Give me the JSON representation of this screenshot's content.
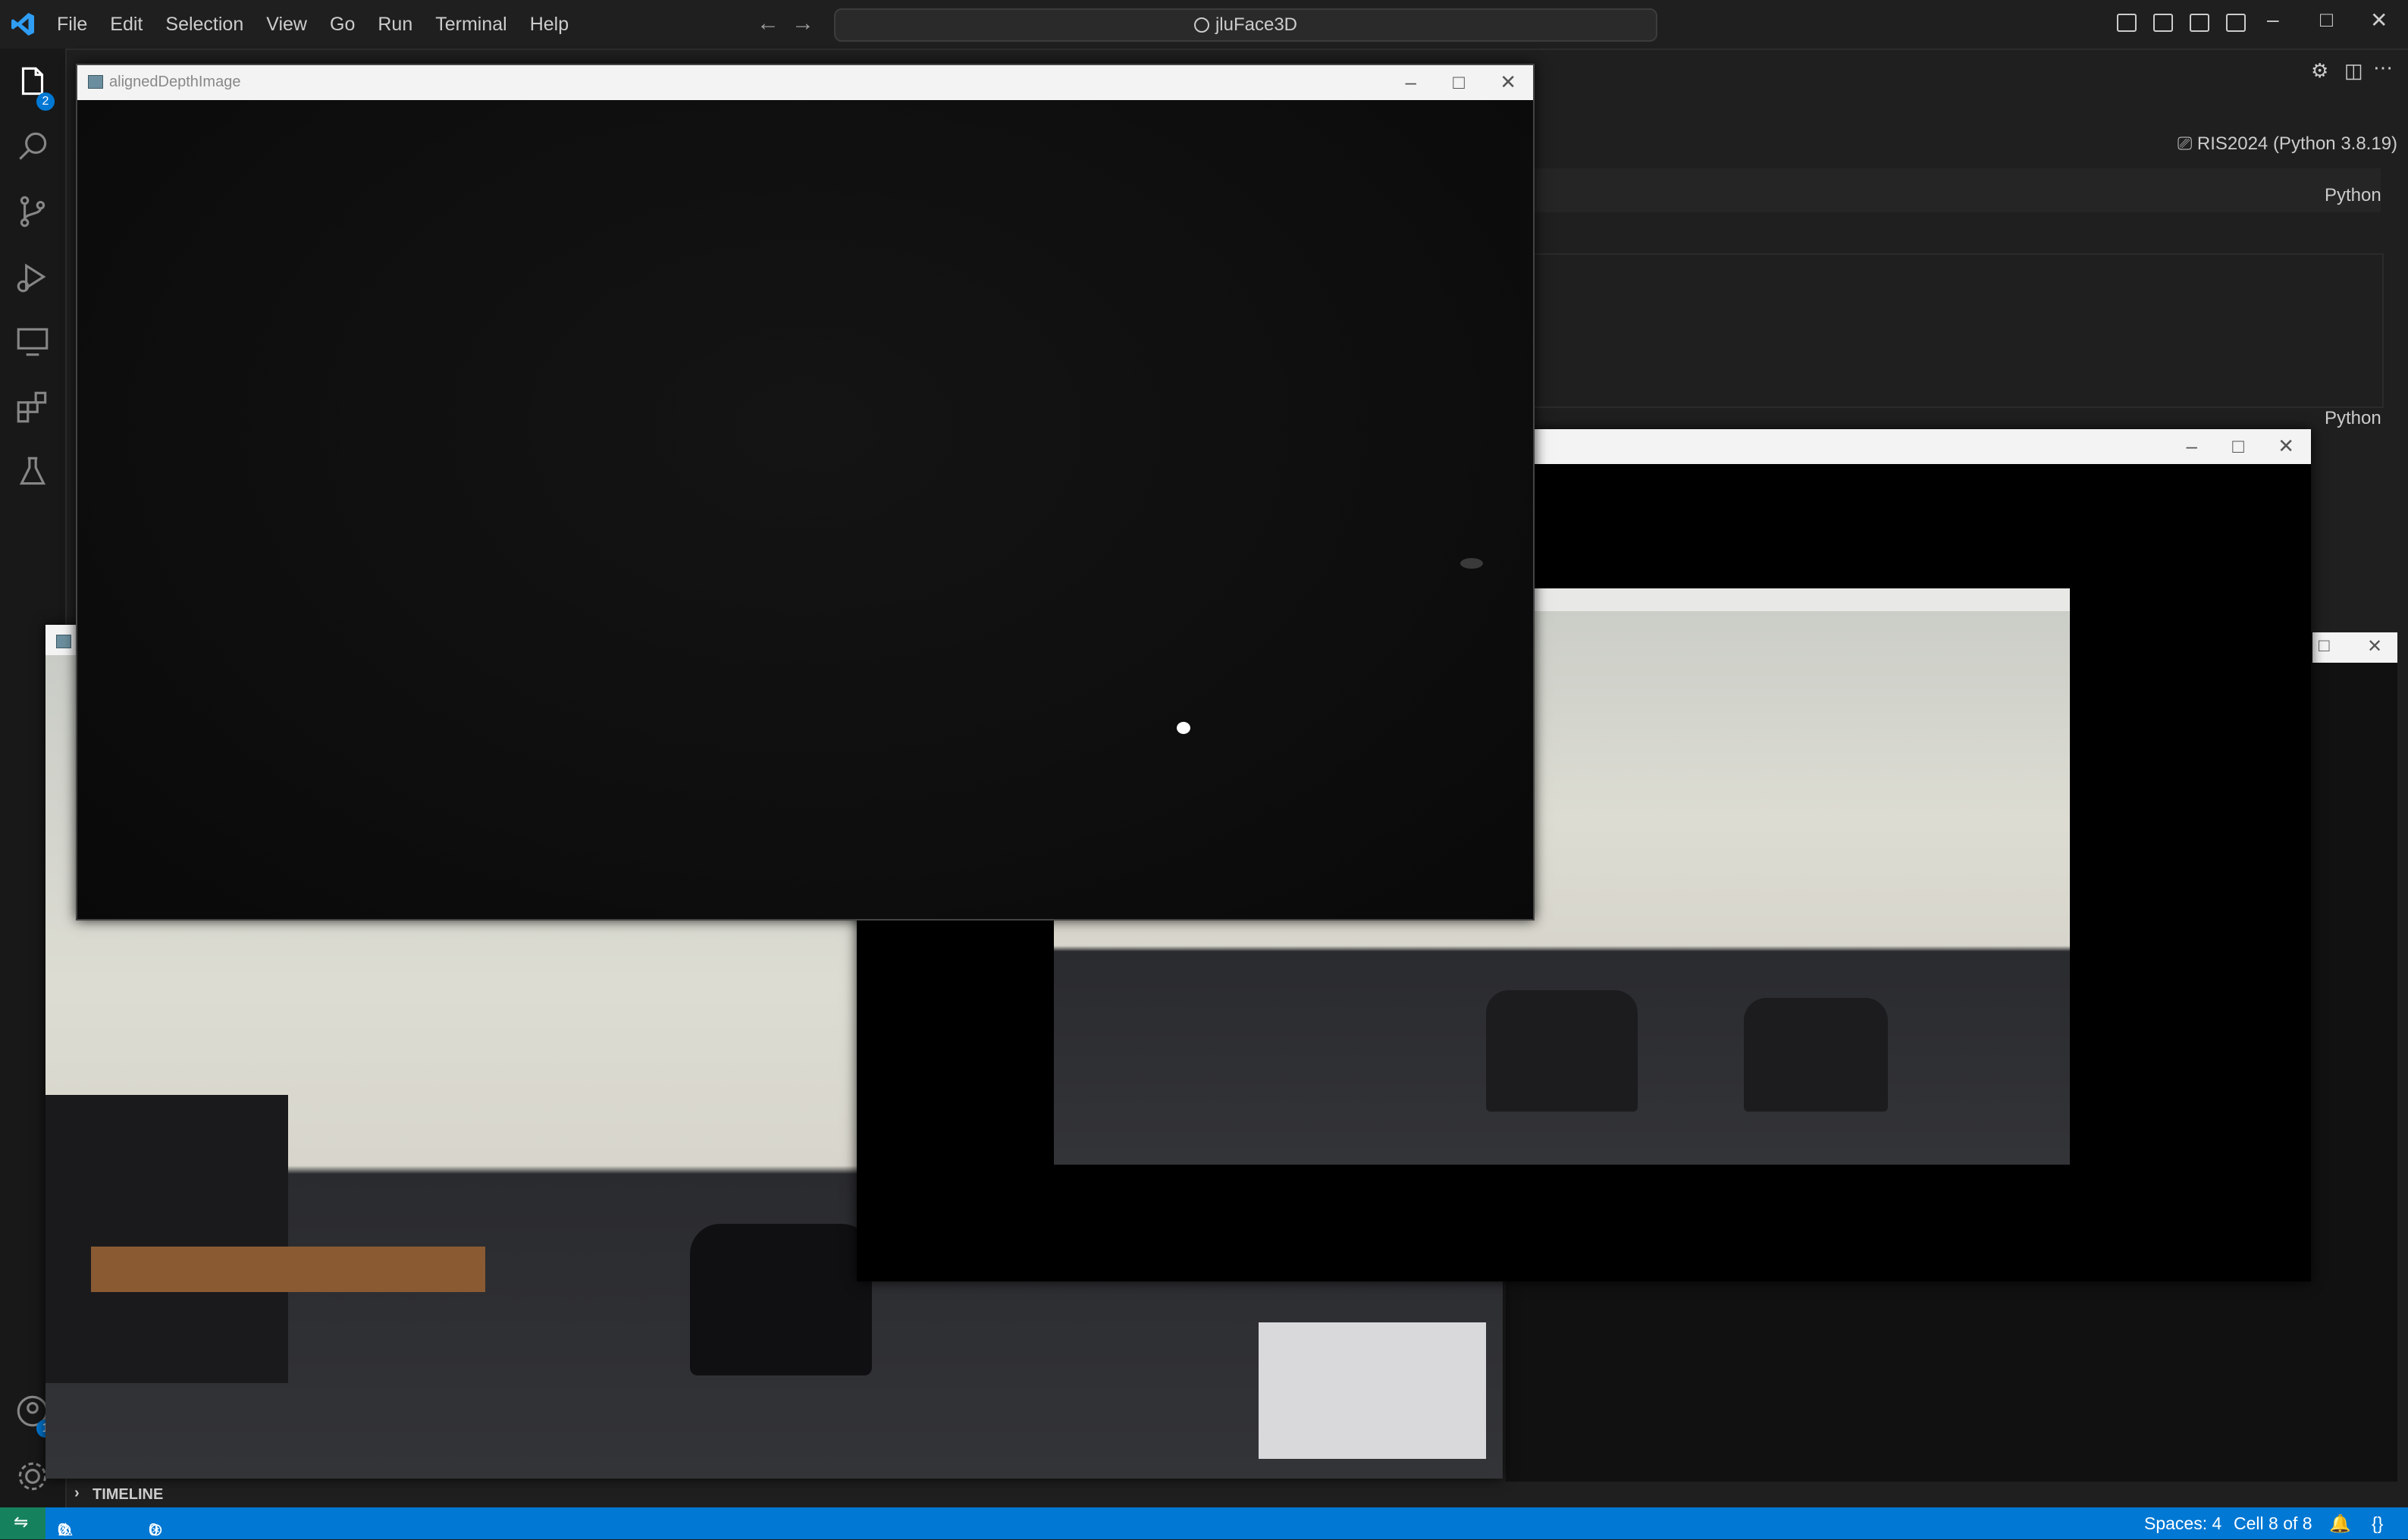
{
  "menu": [
    "File",
    "Edit",
    "Selection",
    "View",
    "Go",
    "Run",
    "Terminal",
    "Help"
  ],
  "command_center": "jluFace3D",
  "activity": {
    "explorer_badge": "2",
    "accounts_badge": "1"
  },
  "kernel": "RIS2024 (Python 3.8.19)",
  "cell_lang_1": "Python",
  "cell_lang_2": "Python",
  "timeline": "TIMELINE",
  "windows": {
    "depth_title": "alignedDepthImage"
  },
  "status": {
    "errors": "0",
    "warnings": "0",
    "ports": "0",
    "spaces": "Spaces: 4",
    "cell": "Cell 8 of 8"
  },
  "colors": {
    "accent": "#0078d4",
    "statusbar": "#0078d4",
    "remote": "#16825d"
  }
}
